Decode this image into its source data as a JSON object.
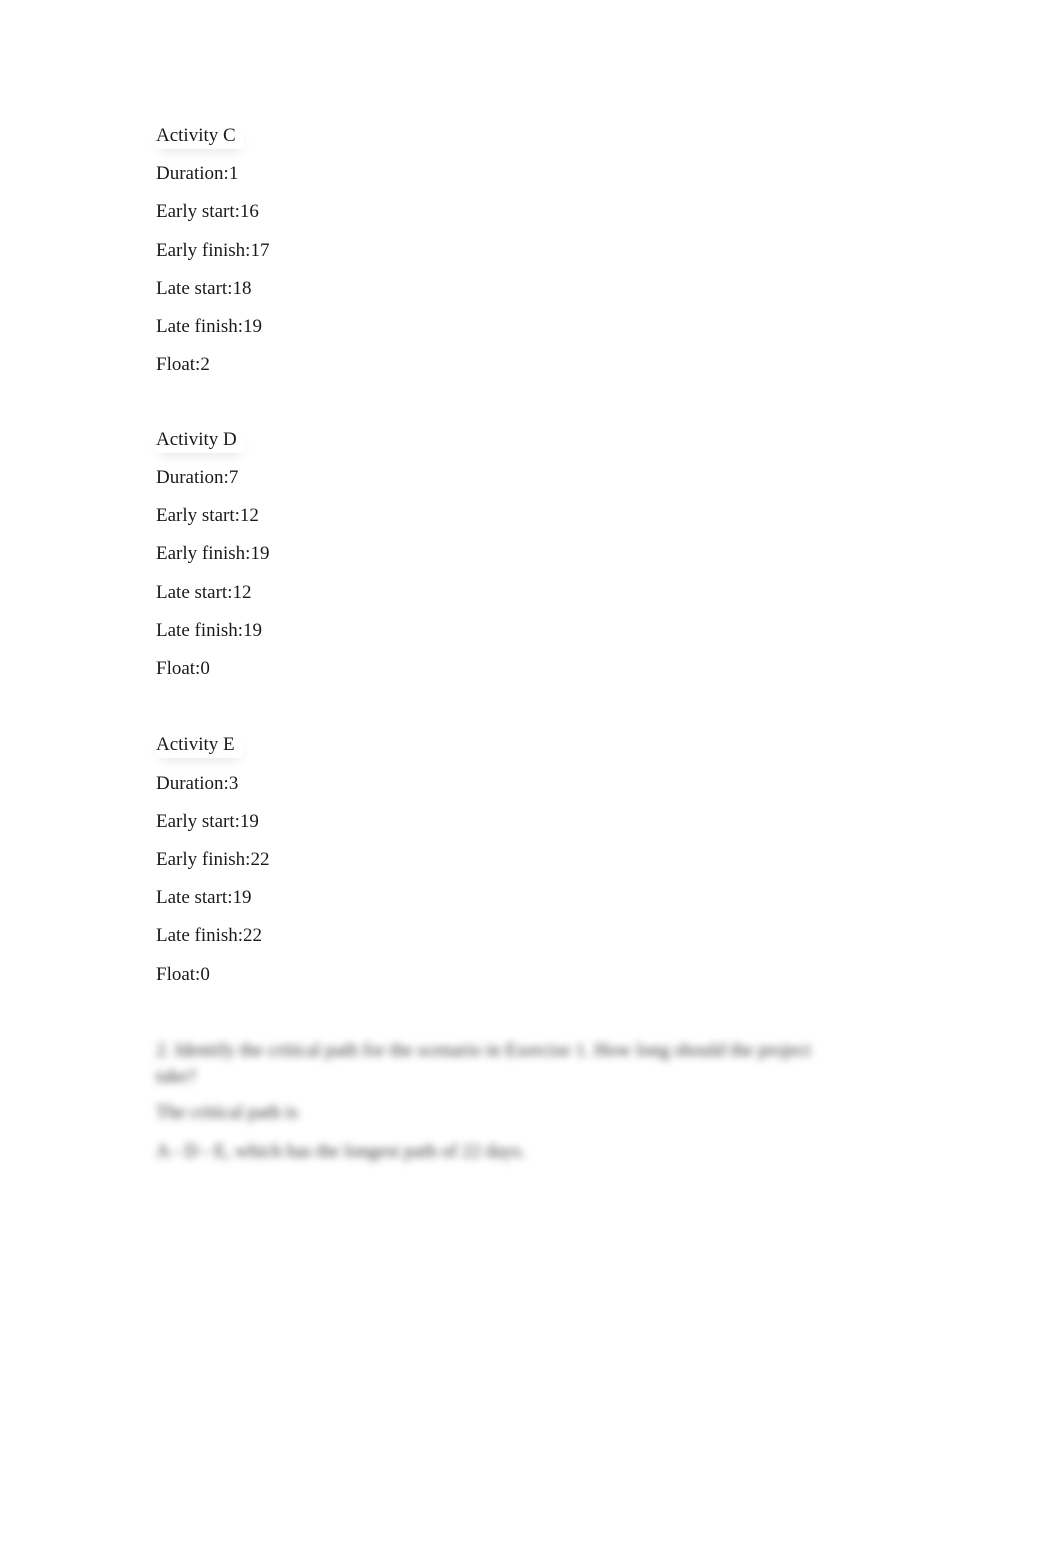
{
  "activities": [
    {
      "title": "Activity C",
      "fields": [
        "Duration:1",
        "Early start:16",
        "Early finish:17",
        "Late start:18",
        "Late finish:19",
        "Float:2"
      ]
    },
    {
      "title": "Activity D",
      "fields": [
        "Duration:7",
        "Early start:12",
        "Early finish:19",
        "Late start:12",
        "Late finish:19",
        "Float:0"
      ]
    },
    {
      "title": "Activity E",
      "fields": [
        "Duration:3",
        "Early start:19",
        "Early finish:22",
        "Late start:19",
        "Late finish:22",
        "Float:0"
      ]
    }
  ],
  "blurred_section": {
    "question": "2. Identify the critical path for the scenario in Exercise 1. How long should the project take?",
    "answer_label": "The critical path is",
    "answer": "A - D - E, which has the longest path of 22 days."
  }
}
